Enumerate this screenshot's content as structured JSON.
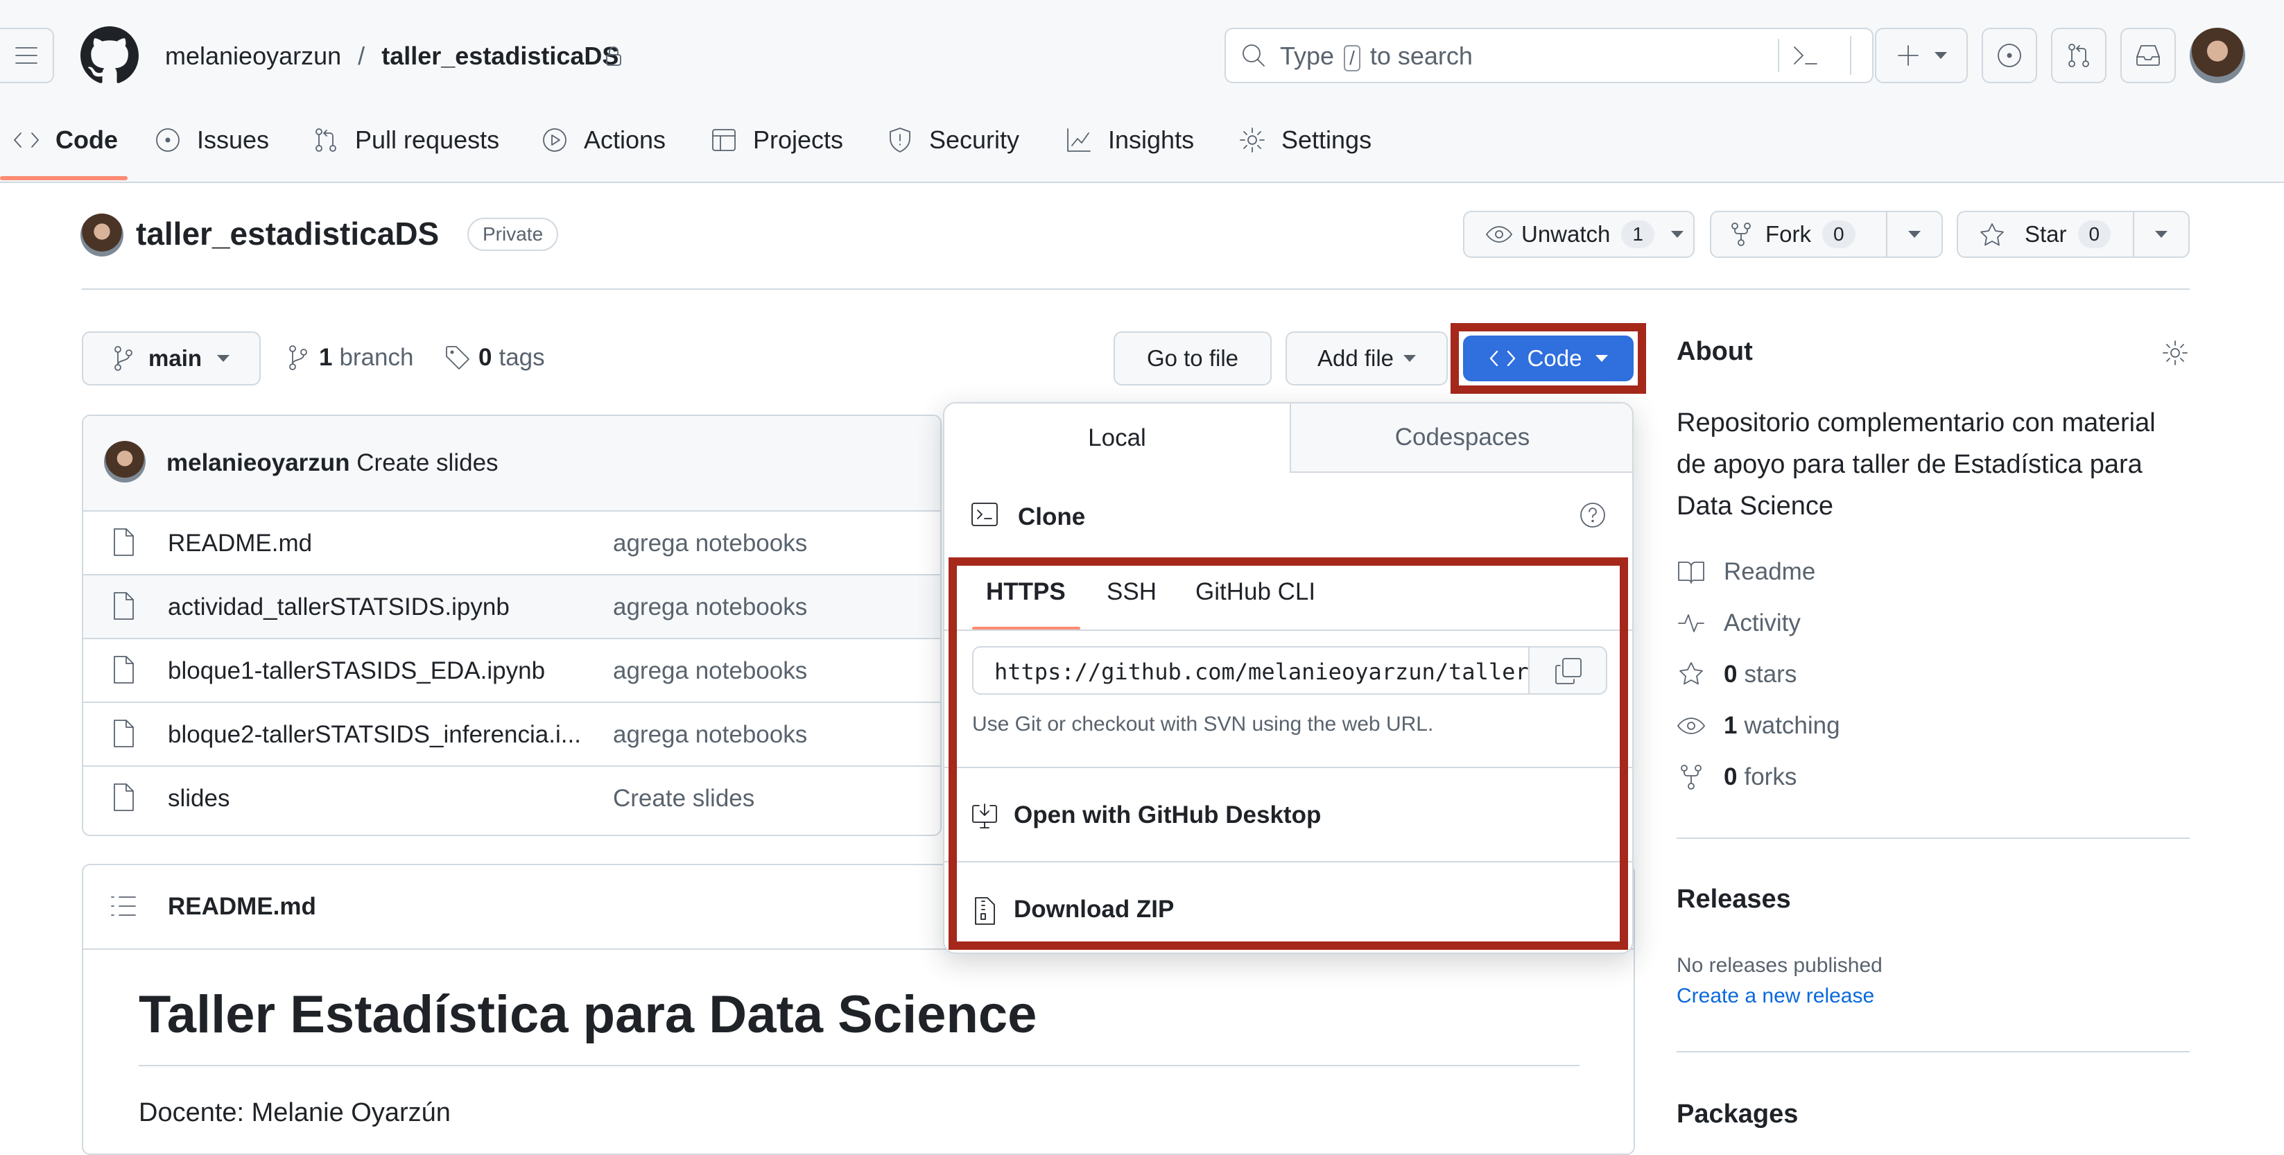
{
  "header": {
    "owner": "melanieoyarzun",
    "separator": "/",
    "repo": "taller_estadisticaDS",
    "search_before": "Type",
    "search_key": "/",
    "search_after": "to search"
  },
  "nav": [
    "Code",
    "Issues",
    "Pull requests",
    "Actions",
    "Projects",
    "Security",
    "Insights",
    "Settings"
  ],
  "repo": {
    "name": "taller_estadisticaDS",
    "visibility": "Private",
    "unwatch_label": "Unwatch",
    "watch_count": "1",
    "fork_label": "Fork",
    "fork_count": "0",
    "star_label": "Star",
    "star_count": "0"
  },
  "toolbar": {
    "branch": "main",
    "branch_count": "1",
    "branch_label": "branch",
    "tag_count": "0",
    "tag_label": "tags",
    "go_to_file": "Go to file",
    "add_file": "Add file",
    "code": "Code"
  },
  "commit": {
    "author": "melanieoyarzun",
    "message": "Create slides"
  },
  "files": [
    {
      "name": "README.md",
      "message": "agrega notebooks"
    },
    {
      "name": "actividad_tallerSTATSIDS.ipynb",
      "message": "agrega notebooks"
    },
    {
      "name": "bloque1-tallerSTASIDS_EDA.ipynb",
      "message": "agrega notebooks"
    },
    {
      "name": "bloque2-tallerSTATSIDS_inferencia.i...",
      "message": "agrega notebooks"
    },
    {
      "name": "slides",
      "message": "Create slides"
    }
  ],
  "readme": {
    "header": "README.md",
    "title": "Taller Estadística para Data Science",
    "docente": "Docente: Melanie Oyarzún"
  },
  "dropdown": {
    "tab_local": "Local",
    "tab_codespaces": "Codespaces",
    "clone": "Clone",
    "subtabs": [
      "HTTPS",
      "SSH",
      "GitHub CLI"
    ],
    "url": "https://github.com/melanieoyarzun/taller_estadisticaDS.git",
    "hint": "Use Git or checkout with SVN using the web URL.",
    "open_desktop": "Open with GitHub Desktop",
    "download_zip": "Download ZIP"
  },
  "about": {
    "title": "About",
    "description": "Repositorio complementario con material de apoyo para taller de Estadística para Data Science",
    "readme": "Readme",
    "activity": "Activity",
    "stars_count": "0",
    "stars_label": "stars",
    "watching_count": "1",
    "watching_label": "watching",
    "forks_count": "0",
    "forks_label": "forks"
  },
  "releases": {
    "title": "Releases",
    "none": "No releases published",
    "create": "Create a new release"
  },
  "packages": {
    "title": "Packages"
  },
  "colors": {
    "accent": "#0969da",
    "primary_button": "#2f6fde",
    "highlight": "#a5281b",
    "active_tab": "#fd8c73"
  }
}
